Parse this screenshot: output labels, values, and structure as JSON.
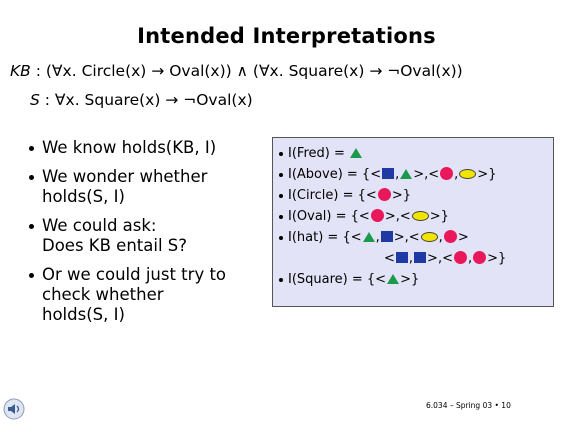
{
  "slide": {
    "title": "Intended Interpretations",
    "kb_formula": {
      "label": "KB",
      "body": " : (∀x. Circle(x) → Oval(x)) ∧ (∀x. Square(x) → ¬Oval(x))"
    },
    "s_formula": {
      "label": "S",
      "body": " : ∀x. Square(x) → ¬Oval(x)"
    },
    "bullets": [
      {
        "lines": [
          "We know holds(KB, I)"
        ]
      },
      {
        "lines": [
          "We wonder whether",
          "holds(S, I)"
        ]
      },
      {
        "lines": [
          "We could ask:",
          "Does KB entail S?"
        ]
      },
      {
        "lines": [
          "Or we could just try to",
          "check whether",
          "holds(S, I)"
        ]
      }
    ],
    "interpretations": [
      {
        "label": "I(Fred) = ",
        "symbols": [
          "triangle"
        ]
      },
      {
        "label": "I(Above) = {<",
        "parts": [
          "square",
          ",",
          "triangle",
          ">,<",
          "circle",
          ",",
          "oval",
          ">}"
        ]
      },
      {
        "label": "I(Circle) = {<",
        "parts": [
          "circle",
          ">}"
        ]
      },
      {
        "label": "I(Oval) = {<",
        "parts": [
          "circle",
          ">,<",
          "oval",
          ">}"
        ]
      },
      {
        "label": "I(hat) = {<",
        "parts": [
          "triangle",
          ",",
          "square",
          ">,<",
          "oval",
          ",",
          "circle",
          ">"
        ]
      },
      {
        "label": "<",
        "parts": [
          "square",
          ",",
          "square",
          ">,<",
          "circle",
          ",",
          "circle",
          ">}"
        ],
        "continuation": true
      },
      {
        "label": "I(Square) = {<",
        "parts": [
          "triangle",
          ">}"
        ]
      }
    ],
    "footer": "6.034 – Spring 03 • 10",
    "colors": {
      "triangle": "#1a9a4a",
      "circle": "#e8185a",
      "oval": "#f0e400",
      "square": "#1f3aa3",
      "box_bg": "#e3e3f7"
    },
    "icons": {
      "speaker": "speaker-icon"
    }
  }
}
